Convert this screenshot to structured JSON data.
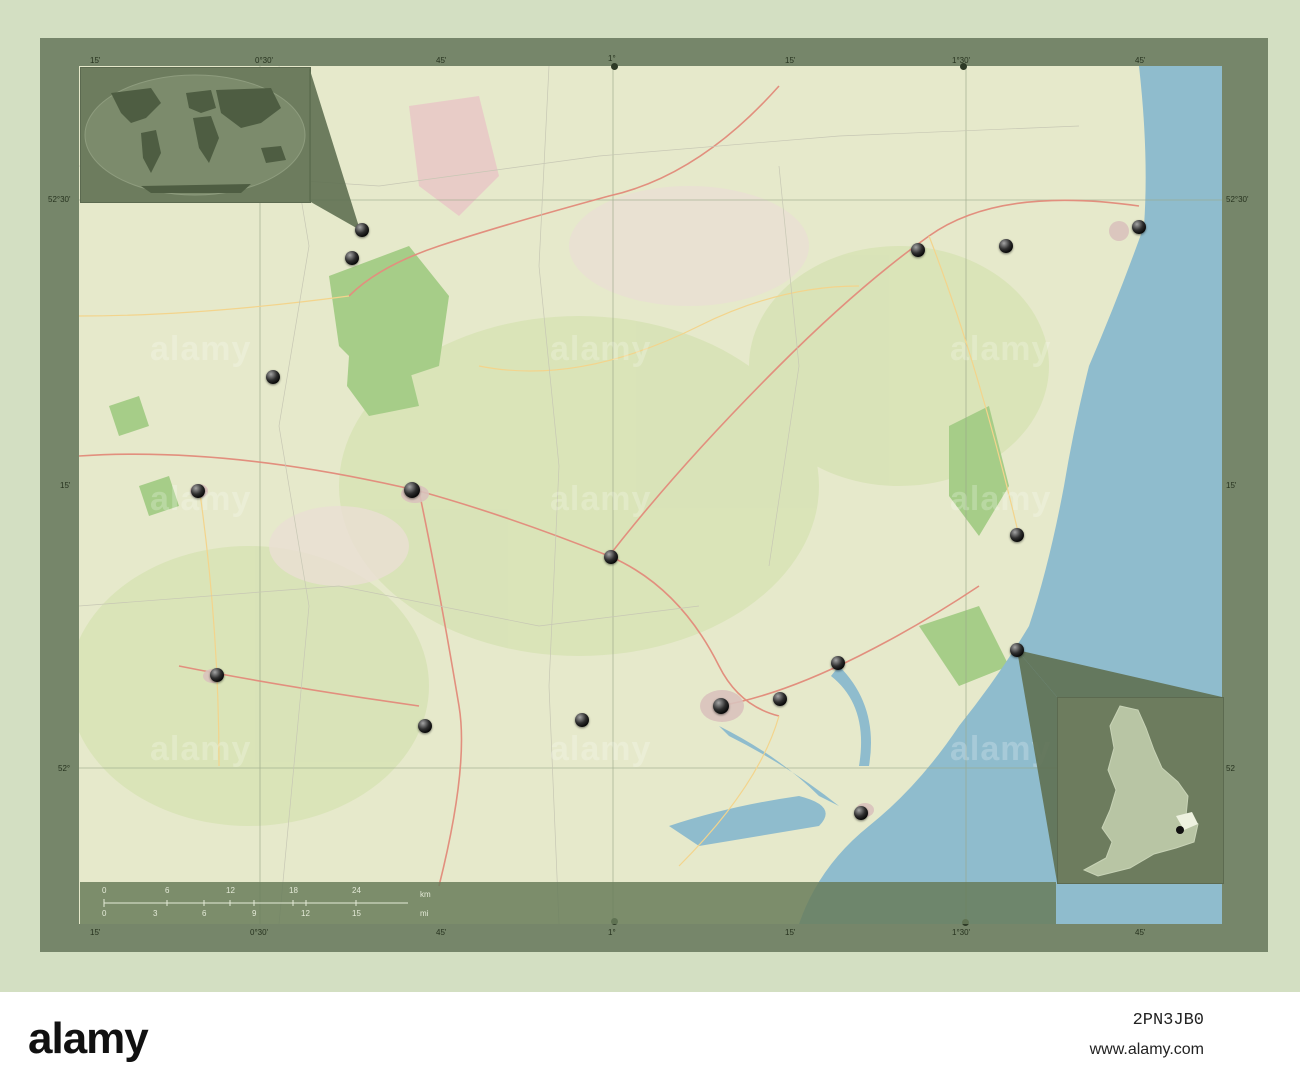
{
  "map": {
    "top_ticks": [
      "15'",
      "0°30'",
      "45'",
      "1°",
      "15'",
      "1°30'",
      "45'"
    ],
    "bottom_ticks": [
      "15'",
      "0°30'",
      "45'",
      "1°",
      "15'",
      "1°30'",
      "45'"
    ],
    "left_ticks": [
      "52°30'",
      "15'",
      "52°"
    ],
    "right_ticks": [
      "52°30'",
      "15'",
      "52"
    ]
  },
  "scale": {
    "km_values": [
      "0",
      "6",
      "12",
      "18",
      "24"
    ],
    "km_unit": "km",
    "mi_values": [
      "0",
      "3",
      "6",
      "9",
      "12",
      "15"
    ],
    "mi_unit": "mi"
  },
  "watermark": "alamy",
  "footer": {
    "logo": "alamy",
    "image_id": "2PN3JB0",
    "site": "www.alamy.com"
  },
  "colors": {
    "sea": "#8fbccd",
    "land": "#e5e7cc",
    "woodland": "#9cc77e",
    "frame": "#76866a",
    "background": "#d3dfc2"
  }
}
